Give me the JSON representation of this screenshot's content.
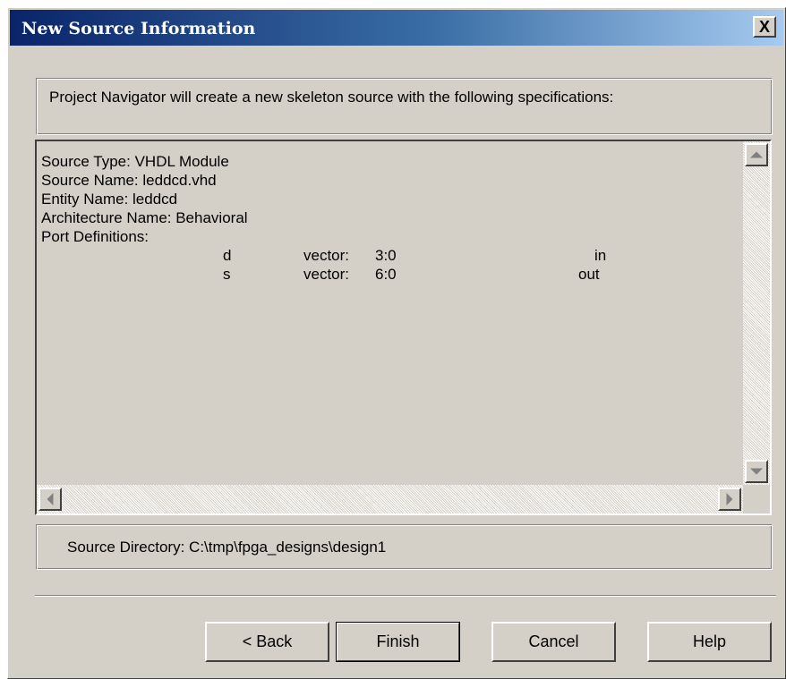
{
  "window": {
    "title": "New Source Information",
    "close_label": "X"
  },
  "intro": {
    "text": "Project Navigator will create a new skeleton source with the following specifications:"
  },
  "spec": {
    "lines": [
      "Source Type:  VHDL Module",
      "Source Name:  leddcd.vhd",
      "Entity Name:  leddcd",
      "Architecture Name:  Behavioral",
      "Port Definitions:"
    ],
    "ports": [
      {
        "name": "d",
        "kind": "vector:",
        "range": "3:0",
        "direction": "in"
      },
      {
        "name": "s",
        "kind": "vector:",
        "range": "6:0",
        "direction": "out"
      }
    ]
  },
  "directory": {
    "text": "Source Directory:  C:\\tmp\\fpga_designs\\design1"
  },
  "buttons": {
    "back": "< Back",
    "finish": "Finish",
    "cancel": "Cancel",
    "help": "Help"
  },
  "icons": {
    "close": "close-icon",
    "scroll_up": "arrow-up-icon",
    "scroll_down": "arrow-down-icon",
    "scroll_left": "arrow-left-icon",
    "scroll_right": "arrow-right-icon"
  },
  "colors": {
    "title_gradient_start": "#0a246a",
    "title_gradient_end": "#a6caf0",
    "dialog_face": "#d4d0c8"
  }
}
